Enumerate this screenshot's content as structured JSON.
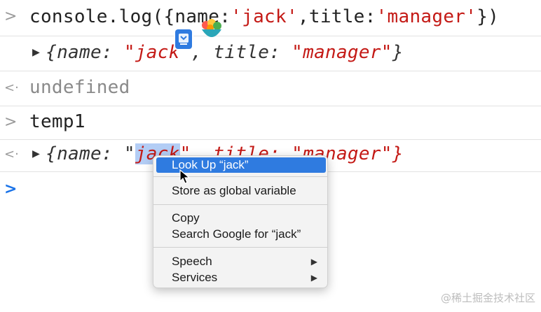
{
  "console": {
    "row1": {
      "gutter": ">",
      "prefix": "console.log({name:",
      "s1": "'jack'",
      "mid": ",title:",
      "s2": "'manager'",
      "suffix": "})"
    },
    "row2": {
      "tri": "▶",
      "open": "{name: ",
      "s1": "\"jack\"",
      "mid": ", title: ",
      "s2": "\"manager\"",
      "close": "}"
    },
    "row3": {
      "gutter": "<·",
      "text": "undefined"
    },
    "row4": {
      "gutter": ">",
      "text": "temp1"
    },
    "row5": {
      "gutter": "<·",
      "tri": "▶",
      "open": "{name: \"",
      "sel": "jack",
      "rest": "\", title: \"manager\"}"
    },
    "row6": {
      "gutter": ">"
    }
  },
  "context_menu": {
    "items": [
      {
        "label": "Look Up “jack”",
        "active": true
      },
      {
        "label": "Store as global variable"
      },
      {
        "label": "Copy"
      },
      {
        "label": "Search Google for “jack”"
      },
      {
        "label": "Speech",
        "submenu": "▶"
      },
      {
        "label": "Services",
        "submenu": "▶"
      }
    ]
  },
  "watermark": "@稀土掘金技术社区",
  "colors": {
    "string": "#c41a16",
    "selection": "#b3cdf5",
    "menu_active": "#2f7be0",
    "prompt": "#1a73e8"
  }
}
